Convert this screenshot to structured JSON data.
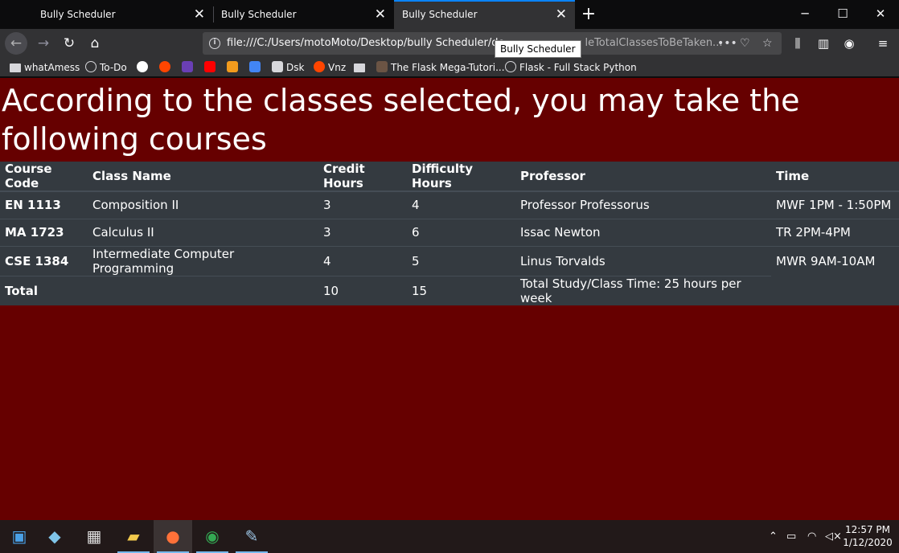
{
  "tabs": [
    {
      "title": "Bully Scheduler"
    },
    {
      "title": "Bully Scheduler"
    },
    {
      "title": "Bully Scheduler"
    }
  ],
  "navbar": {
    "url": "file:///C:/Users/motoMoto/Desktop/bully Scheduler/de",
    "url_tail": "leTotalClassesToBeTaken...",
    "tooltip": "Bully Scheduler"
  },
  "bookmarks": [
    {
      "label": "whatAmess",
      "icon": "folder-icon"
    },
    {
      "label": "To-Do",
      "icon": "globe-icon"
    },
    {
      "label": "",
      "icon": "google-icon",
      "color": "#ffffff"
    },
    {
      "label": "",
      "icon": "reddit-icon",
      "color": "#ff4500"
    },
    {
      "label": "",
      "icon": "ar-icon",
      "color": "#6a3fb5"
    },
    {
      "label": "",
      "icon": "youtube-icon",
      "color": "#ff0000"
    },
    {
      "label": "",
      "icon": "rss-icon",
      "color": "#f29b1d"
    },
    {
      "label": "",
      "icon": "translate-icon",
      "color": "#4285f4"
    },
    {
      "label": "Dsk",
      "icon": "drive-icon"
    },
    {
      "label": "Vnz",
      "icon": "reddit-icon"
    },
    {
      "label": "",
      "icon": "folder-icon"
    },
    {
      "label": "The Flask Mega-Tutori...",
      "icon": "avatar-icon"
    },
    {
      "label": "Flask - Full Stack Python",
      "icon": "globe-icon"
    }
  ],
  "page": {
    "heading": "According to the classes selected, you may take the following courses"
  },
  "table": {
    "headers": [
      "Course Code",
      "Class Name",
      "Credit Hours",
      "Difficulty Hours",
      "Professor",
      "Time"
    ],
    "rows": [
      {
        "code": "EN 1113",
        "name": "Composition II",
        "credits": "3",
        "difficulty": "4",
        "professor": "Professor Professorus",
        "time": "MWF 1PM - 1:50PM"
      },
      {
        "code": "MA 1723",
        "name": "Calculus II",
        "credits": "3",
        "difficulty": "6",
        "professor": "Issac Newton",
        "time": "TR 2PM-4PM"
      },
      {
        "code": "CSE 1384",
        "name": "Intermediate Computer Programming",
        "credits": "4",
        "difficulty": "5",
        "professor": "Linus Torvalds",
        "time": "MWR 9AM-10AM"
      }
    ],
    "total": {
      "label": "Total",
      "credits": "10",
      "difficulty": "15",
      "summary": "Total Study/Class Time: 25 hours per week"
    }
  },
  "colors": {
    "page_background": "#660000",
    "table_background": "#343a40",
    "accent": "#0a84ff"
  },
  "taskbar": {
    "time": "12:57 PM",
    "date": "1/12/2020"
  }
}
